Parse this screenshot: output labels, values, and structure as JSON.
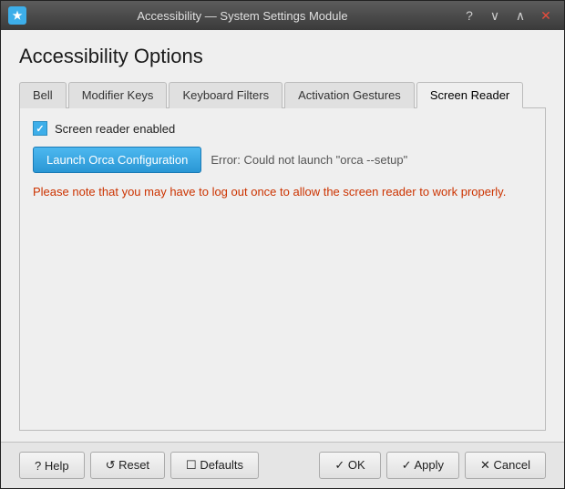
{
  "window": {
    "title": "Accessibility — System Settings Module",
    "icon_label": "★"
  },
  "titlebar": {
    "help_btn": "?",
    "minimize_btn": "∨",
    "maximize_btn": "∧",
    "close_btn": "✕"
  },
  "page": {
    "title": "Accessibility Options"
  },
  "tabs": [
    {
      "label": "Bell",
      "active": false
    },
    {
      "label": "Modifier Keys",
      "active": false
    },
    {
      "label": "Keyboard Filters",
      "active": false
    },
    {
      "label": "Activation Gestures",
      "active": false
    },
    {
      "label": "Screen Reader",
      "active": true
    }
  ],
  "screen_reader": {
    "checkbox_label": "Screen reader enabled",
    "launch_btn_label": "Launch Orca Configuration",
    "error_text": "Error: Could not launch \"orca --setup\"",
    "note_text": "Please note that you may have to log out once to allow the screen reader to work properly."
  },
  "footer": {
    "help_label": "? Help",
    "reset_label": "↺ Reset",
    "defaults_label": "☐ Defaults",
    "ok_label": "✓ OK",
    "apply_label": "✓ Apply",
    "cancel_label": "✕ Cancel"
  }
}
